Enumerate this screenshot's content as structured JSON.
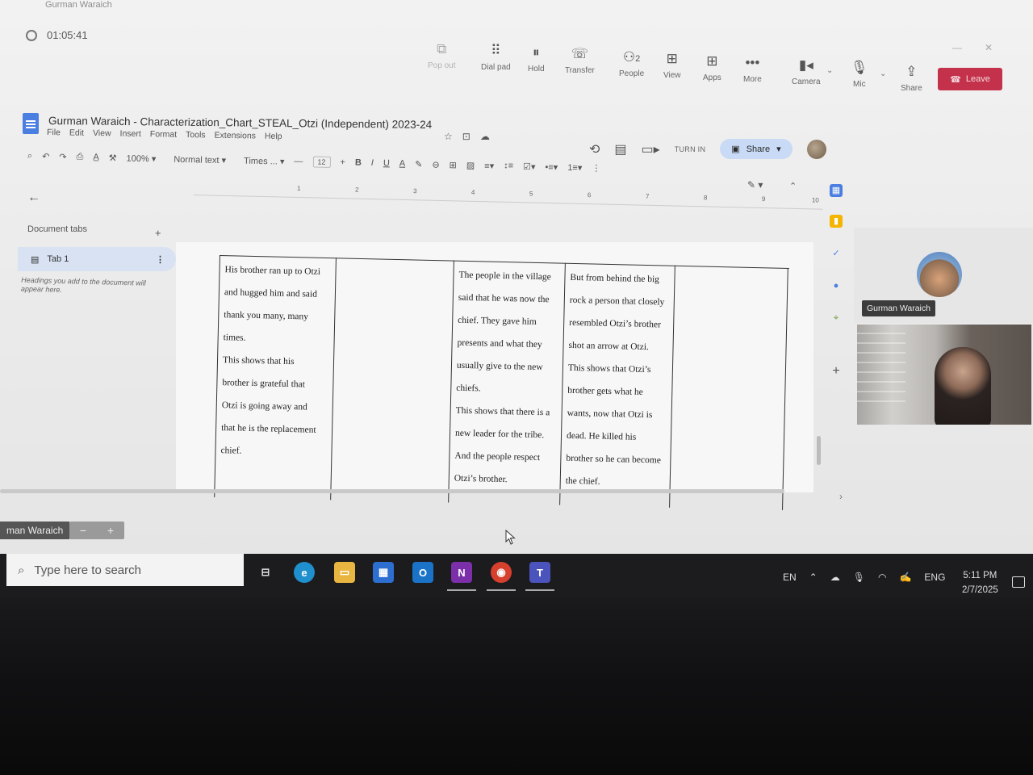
{
  "teams": {
    "window_title": "Gurman Waraich",
    "timer": "01:05:41",
    "controls": [
      {
        "label": "Pop out",
        "icon": "pop-out-icon",
        "glyph": "⧉",
        "dim": true
      },
      {
        "label": "Dial pad",
        "icon": "dial-pad-icon",
        "glyph": "⠿"
      },
      {
        "label": "Hold",
        "icon": "hold-icon",
        "glyph": "⏸"
      },
      {
        "label": "Transfer",
        "icon": "transfer-icon",
        "glyph": "☏"
      },
      {
        "label": "People",
        "icon": "people-icon",
        "glyph": "⚇",
        "badge": "2"
      },
      {
        "label": "View",
        "icon": "view-icon",
        "glyph": "⊞"
      },
      {
        "label": "Apps",
        "icon": "apps-icon",
        "glyph": "⊞"
      },
      {
        "label": "More",
        "icon": "more-icon",
        "glyph": "•••"
      },
      {
        "label": "Camera",
        "icon": "camera-icon",
        "glyph": "▮◂"
      },
      {
        "label": "Mic",
        "icon": "mic-icon",
        "glyph": "🎙"
      },
      {
        "label": "Share",
        "icon": "share-icon",
        "glyph": "⇪"
      }
    ],
    "leave_label": "Leave",
    "participant_name": "Gurman Waraich",
    "self_name_partial": "man Waraich"
  },
  "docs": {
    "title": "Gurman Waraich - Characterization_Chart_STEAL_Otzi (Independent) 2023-24",
    "menu": [
      "File",
      "Edit",
      "View",
      "Insert",
      "Format",
      "Tools",
      "Extensions",
      "Help"
    ],
    "turn_in_label": "TURN IN",
    "share_label": "Share",
    "toolbar": {
      "zoom": "100%",
      "style": "Normal text",
      "font": "Times ...",
      "font_size": "12"
    },
    "ruler_ticks": [
      "1",
      "2",
      "3",
      "4",
      "5",
      "6",
      "7",
      "8",
      "9",
      "10"
    ],
    "sidebar": {
      "document_tabs_label": "Document tabs",
      "tab_name": "Tab 1",
      "headings_hint": "Headings you add to the document will appear here."
    },
    "table_cells": [
      [
        "His brother ran up to Otzi",
        "and hugged him and said",
        "thank you many, many",
        "times.",
        "This shows that his",
        "brother is grateful that",
        "Otzi is going away and",
        "that he is the replacement",
        "chief."
      ],
      [],
      [
        "The people in the village",
        "said that he was now the",
        "chief. They gave him",
        "presents and what  they",
        "usually give to the new",
        "chiefs.",
        "This shows that there is a",
        "new leader for the tribe.",
        "And the people respect",
        "Otzi’s brother."
      ],
      [
        "But from behind the big",
        "rock a person that closely",
        "resembled Otzi’s brother",
        "shot an arrow at Otzi.",
        " This shows that Otzi’s",
        "brother gets what  he",
        "wants, now that Otzi is",
        "dead. He killed his",
        "brother so he can become",
        "the chief."
      ],
      []
    ]
  },
  "taskbar": {
    "search_placeholder": "Type here to search",
    "language": "EN",
    "input_lang": "ENG",
    "time": "5:11 PM",
    "date": "2/7/2025"
  },
  "colors": {
    "leave_red": "#c4314b",
    "share_blue": "#c8daf5",
    "tab_highlight": "#d8e2f3"
  }
}
